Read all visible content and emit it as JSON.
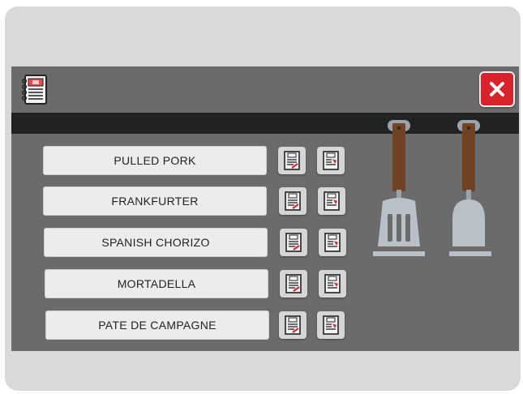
{
  "header": {
    "book_icon": "recipe-book-icon",
    "close_icon": "close-icon"
  },
  "items": [
    {
      "label": "PULLED PORK"
    },
    {
      "label": "FRANKFURTER"
    },
    {
      "label": "SPANISH CHORIZO"
    },
    {
      "label": "MORTADELLA"
    },
    {
      "label": "PATE DE CAMPAGNE"
    }
  ],
  "actions": {
    "edit_icon": "document-edit-icon",
    "delete_icon": "document-delete-icon"
  },
  "colors": {
    "panel": "#6b6b6b",
    "bar": "#222222",
    "close_red": "#d9232b",
    "handle_brown": "#6e4424",
    "spatula_gray": "#b9c0c7"
  }
}
